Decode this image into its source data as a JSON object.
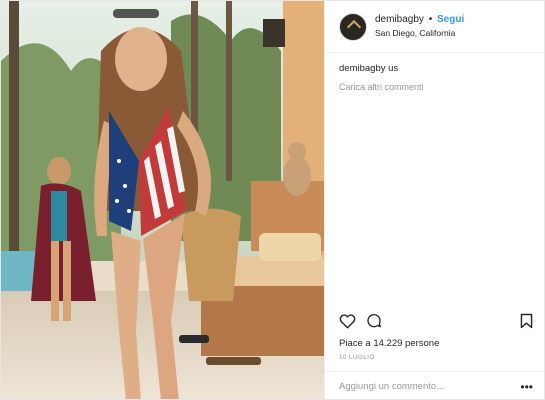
{
  "post": {
    "username": "demibagby",
    "separator": "•",
    "follow_label": "Segui",
    "location": "San Diego, California",
    "caption_user": "demibagby",
    "caption_text": "us",
    "load_more": "Carica altri commenti",
    "likes": "Piace a 14.229 persone",
    "date": "10 LUGLIO",
    "comment_placeholder": "Aggiungi un commento...",
    "more_options": "•••"
  },
  "icons": {
    "like": "heart-icon",
    "comment": "comment-icon",
    "save": "bookmark-icon"
  },
  "colors": {
    "accent": "#3897f0",
    "muted": "#999999",
    "text": "#262626"
  }
}
